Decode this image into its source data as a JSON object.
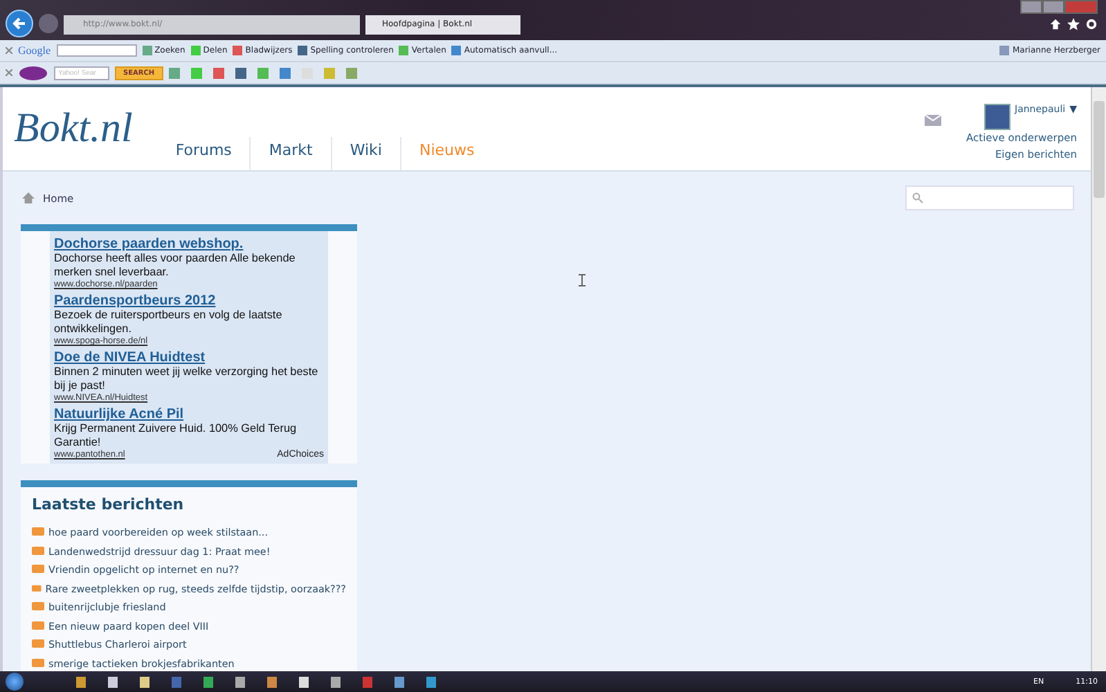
{
  "browser": {
    "address": "http://www.bokt.nl/",
    "tab_title": "Hoofdpagina | Bokt.nl"
  },
  "toolbar_1": {
    "brand": "Google",
    "items": [
      "Zoeken",
      "Delen",
      "Bladwijzers",
      "Spelling controleren",
      "Vertalen",
      "Automatisch aanvull..."
    ],
    "user": "Marianne Herzberger"
  },
  "toolbar_2": {
    "search_placeholder": "Yahoo! Sear",
    "search_button": "SEARCH"
  },
  "site": {
    "logo": "Bokt.nl",
    "nav": [
      {
        "label": "Forums",
        "selected": false
      },
      {
        "label": "Markt",
        "selected": false
      },
      {
        "label": "Wiki",
        "selected": false
      },
      {
        "label": "Nieuws",
        "selected": true
      }
    ],
    "user": "Jannepauli",
    "user_menu": "▼",
    "links": [
      "Actieve onderwerpen",
      "Eigen berichten"
    ],
    "breadcrumb": "Home"
  },
  "ads": {
    "items": [
      {
        "title": "Dochorse paarden webshop.",
        "text": "Dochorse heeft alles voor paarden Alle bekende merken snel leverbaar.",
        "url": "www.dochorse.nl/paarden"
      },
      {
        "title": "Paardensportbeurs 2012",
        "text": "Bezoek de ruitersportbeurs en volg de laatste ontwikkelingen.",
        "url": "www.spoga-horse.de/nl"
      },
      {
        "title": "Doe de NIVEA Huidtest",
        "text": "Binnen 2 minuten weet jij welke verzorging het beste bij je past!",
        "url": "www.NIVEA.nl/Huidtest"
      },
      {
        "title": "Natuurlijke Acné Pil",
        "text": "Krijg Permanent Zuivere Huid. 100% Geld Terug Garantie!",
        "url": "www.pantothen.nl"
      }
    ],
    "adchoices": "AdChoices"
  },
  "latest": {
    "title": "Laatste berichten",
    "items": [
      "hoe paard voorbereiden op week stilstaan...",
      "Landenwedstrijd dressuur dag 1: Praat mee!",
      "Vriendin opgelicht op internet en nu??",
      "Rare zweetplekken op rug, steeds zelfde tijdstip, oorzaak???",
      "buitenrijclubje friesland",
      "Een nieuw paard kopen deel VIII",
      "Shuttlebus Charleroi airport",
      "smerige tactieken brokjesfabrikanten"
    ]
  },
  "taskbar": {
    "language": "EN",
    "time": "11:10"
  }
}
